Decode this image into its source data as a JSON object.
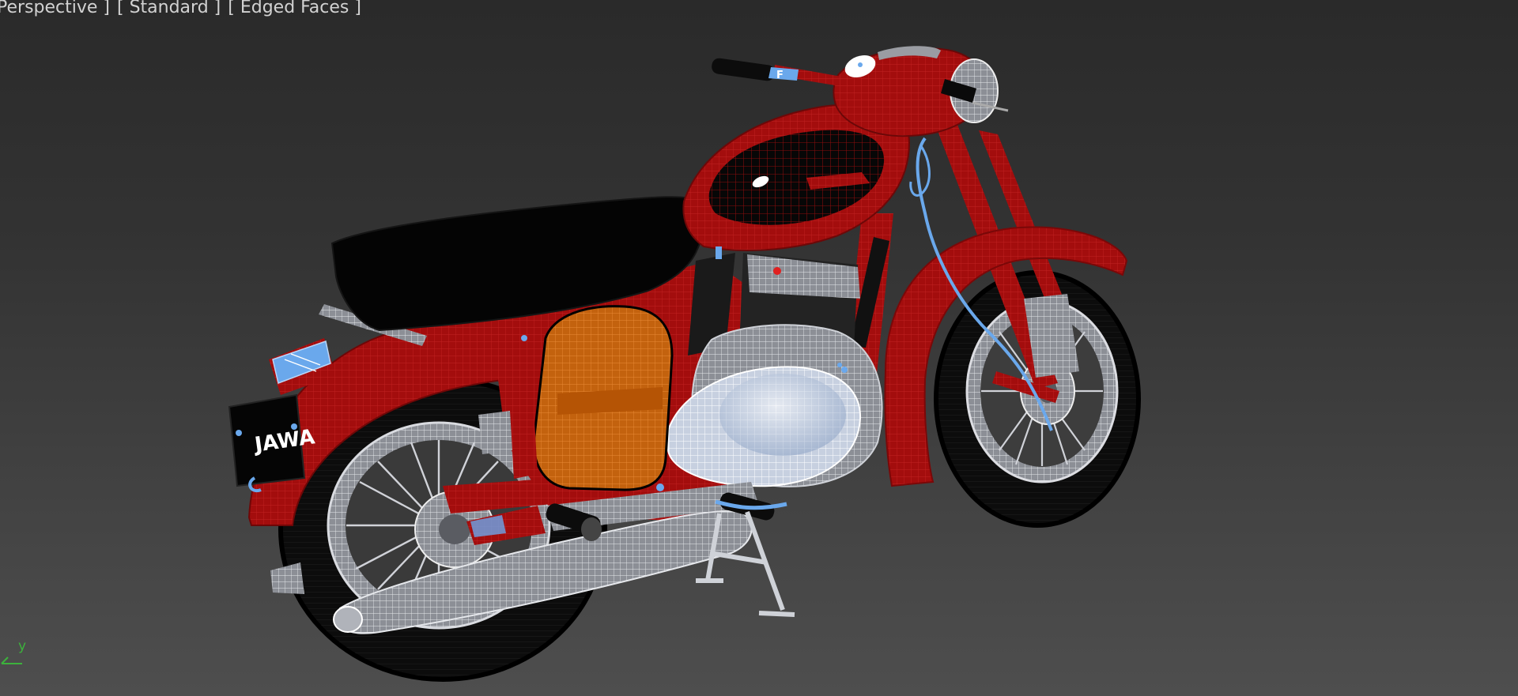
{
  "viewport": {
    "labels": {
      "view": "Perspective ]",
      "shading": "[ Standard ]",
      "edges": "[ Edged Faces ]"
    },
    "axis_label": "y"
  },
  "model": {
    "plate_text": "JAWA",
    "colors": {
      "body": "#a50e0e",
      "seat": "#050505",
      "chrome": "#c9ccd2",
      "highlight": "#6aa8ec",
      "side_cover": "#c86a14",
      "background_top": "#2a2a2a",
      "background_bottom": "#4e4e4e"
    }
  }
}
